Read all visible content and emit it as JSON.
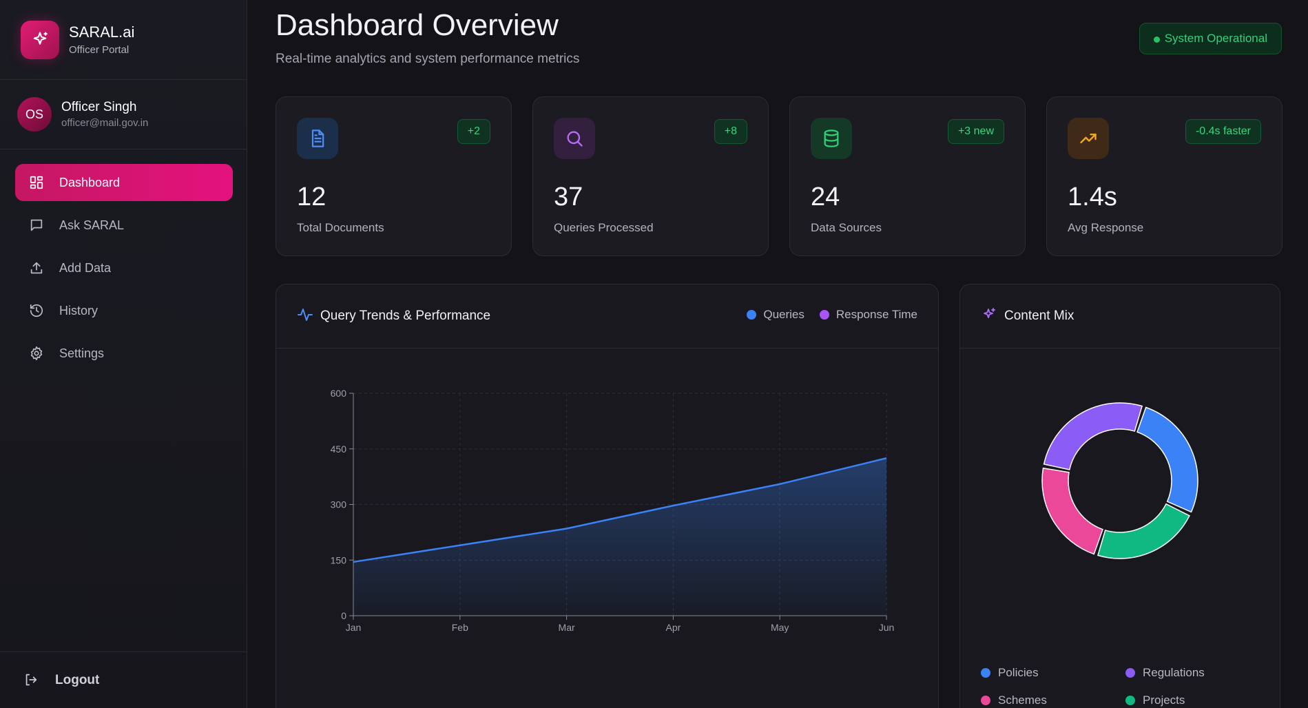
{
  "brand": {
    "name": "SARAL.ai",
    "subtitle": "Officer Portal"
  },
  "user": {
    "initials": "OS",
    "name": "Officer Singh",
    "email": "officer@mail.gov.in"
  },
  "nav": [
    {
      "label": "Dashboard",
      "icon": "grid-icon",
      "active": true
    },
    {
      "label": "Ask SARAL",
      "icon": "chat-icon",
      "active": false
    },
    {
      "label": "Add Data",
      "icon": "upload-icon",
      "active": false
    },
    {
      "label": "History",
      "icon": "history-icon",
      "active": false
    },
    {
      "label": "Settings",
      "icon": "gear-icon",
      "active": false
    }
  ],
  "logout_label": "Logout",
  "header": {
    "title": "Dashboard Overview",
    "subtitle": "Real-time analytics and system performance metrics",
    "status": "System Operational"
  },
  "stats": [
    {
      "value": "12",
      "label": "Total Documents",
      "badge": "+2",
      "icon": "document-icon",
      "color": "#3b82f6"
    },
    {
      "value": "37",
      "label": "Queries Processed",
      "badge": "+8",
      "icon": "search-icon",
      "color": "#a855f7"
    },
    {
      "value": "24",
      "label": "Data Sources",
      "badge": "+3 new",
      "icon": "database-icon",
      "color": "#22c55e"
    },
    {
      "value": "1.4s",
      "label": "Avg Response",
      "badge": "-0.4s faster",
      "icon": "trending-up-icon",
      "color": "#f59e0b"
    }
  ],
  "trends_panel": {
    "title": "Query Trends & Performance",
    "legend": [
      {
        "name": "Queries",
        "color": "#3b82f6"
      },
      {
        "name": "Response Time",
        "color": "#a855f7"
      }
    ]
  },
  "mix_panel": {
    "title": "Content Mix",
    "legend": [
      {
        "name": "Policies",
        "color": "#3b82f6"
      },
      {
        "name": "Regulations",
        "color": "#8b5cf6"
      },
      {
        "name": "Schemes",
        "color": "#ec4899"
      },
      {
        "name": "Projects",
        "color": "#10b981"
      }
    ]
  },
  "chart_data": [
    {
      "type": "area",
      "categories": [
        "Jan",
        "Feb",
        "Mar",
        "Apr",
        "May",
        "Jun"
      ],
      "series": [
        {
          "name": "Queries",
          "values": [
            145,
            190,
            235,
            297,
            355,
            425
          ],
          "color": "#3b82f6"
        }
      ],
      "yticks": [
        0,
        150,
        300,
        450,
        600
      ],
      "ylim": [
        0,
        600
      ],
      "grid": true
    },
    {
      "type": "pie",
      "donut": true,
      "categories": [
        "Policies",
        "Projects",
        "Schemes",
        "Regulations"
      ],
      "values": [
        27,
        23,
        23,
        27
      ],
      "colors": [
        "#3b82f6",
        "#10b981",
        "#ec4899",
        "#8b5cf6"
      ]
    }
  ]
}
